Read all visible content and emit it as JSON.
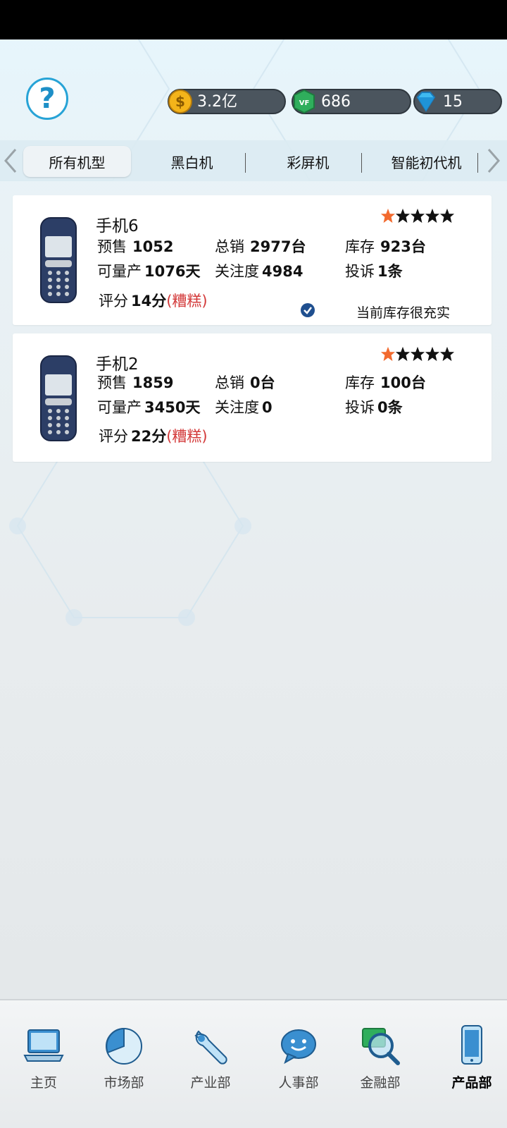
{
  "currency": {
    "gold": "3.2亿",
    "green": "686",
    "gem": "15"
  },
  "tabs": [
    {
      "label": "所有机型"
    },
    {
      "label": "黑白机"
    },
    {
      "label": "彩屏机"
    },
    {
      "label": "智能初代机"
    }
  ],
  "products": [
    {
      "name": "手机6",
      "stars_filled": 1,
      "stars_total": 5,
      "presale_label": "预售",
      "presale": "1052",
      "total_sales_label": "总销",
      "total_sales": "2977台",
      "stock_label": "库存",
      "stock": "923台",
      "producible_label": "可量产",
      "producible": "1076天",
      "attention_label": "关注度",
      "attention": "4984",
      "complaints_label": "投诉",
      "complaints": "1条",
      "rating_label": "评分",
      "rating": "14分",
      "rating_note": "(糟糕)",
      "stock_note": "当前库存很充实"
    },
    {
      "name": "手机2",
      "stars_filled": 1,
      "stars_total": 5,
      "presale_label": "预售",
      "presale": "1859",
      "total_sales_label": "总销",
      "total_sales": "0台",
      "stock_label": "库存",
      "stock": "100台",
      "producible_label": "可量产",
      "producible": "3450天",
      "attention_label": "关注度",
      "attention": "0",
      "complaints_label": "投诉",
      "complaints": "0条",
      "rating_label": "评分",
      "rating": "22分",
      "rating_note": "(糟糕)"
    }
  ],
  "nav": [
    {
      "label": "主页",
      "icon": "laptop-icon"
    },
    {
      "label": "市场部",
      "icon": "pie-chart-icon"
    },
    {
      "label": "产业部",
      "icon": "wrench-icon"
    },
    {
      "label": "人事部",
      "icon": "chat-smile-icon"
    },
    {
      "label": "金融部",
      "icon": "magnifier-icon"
    },
    {
      "label": "产品部",
      "icon": "phone-icon",
      "active": true
    }
  ],
  "colors": {
    "accent": "#27a3d6",
    "bad": "#d33a3a",
    "star_filled": "#f26a2e",
    "star_empty": "#111111"
  }
}
